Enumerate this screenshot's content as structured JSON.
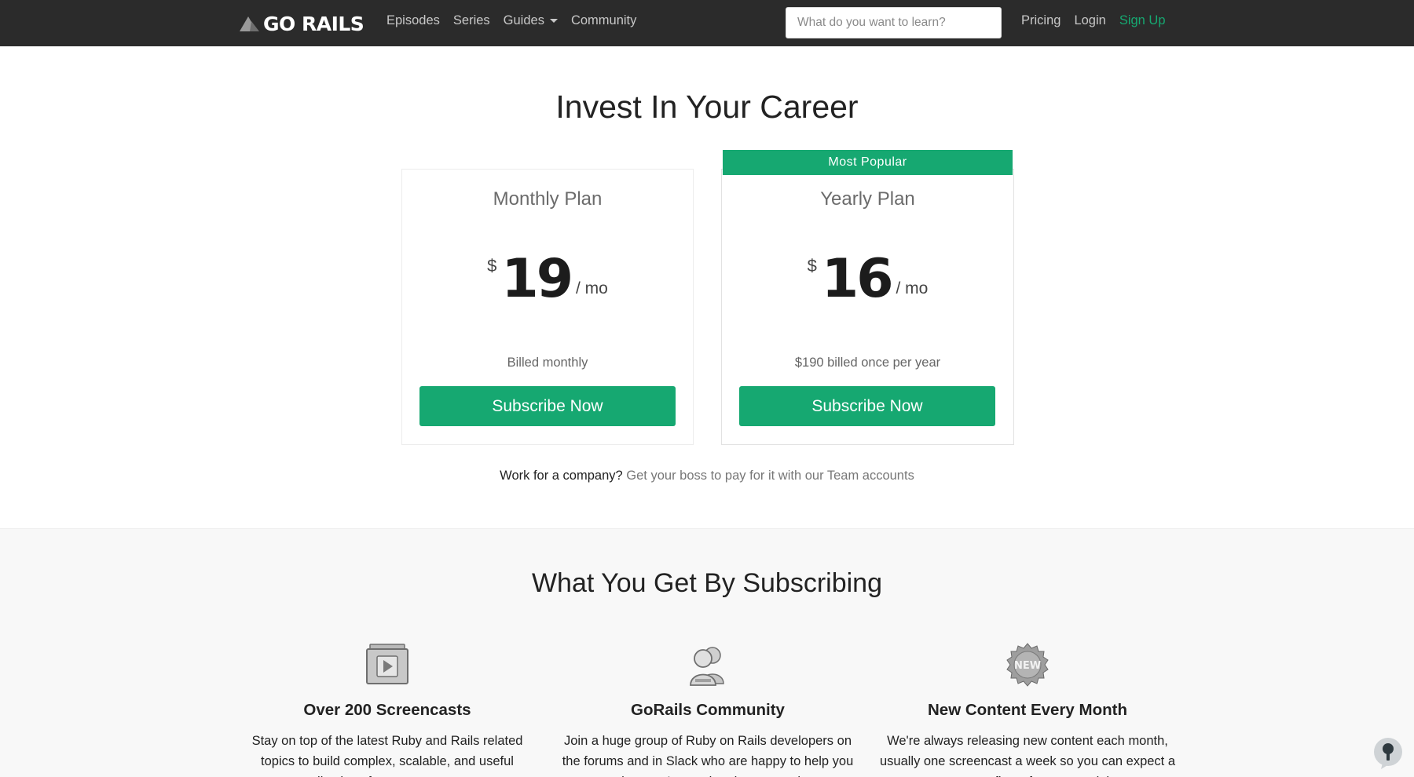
{
  "navbar": {
    "logo_text": "GO RAILS",
    "links": [
      "Episodes",
      "Series",
      "Guides",
      "Community"
    ],
    "search_placeholder": "What do you want to learn?",
    "right_links": [
      "Pricing",
      "Login",
      "Sign Up"
    ]
  },
  "hero": {
    "title": "Invest In Your Career"
  },
  "plans": [
    {
      "name": "Monthly Plan",
      "currency": "$",
      "price": "19",
      "period": "/ mo",
      "billing": "Billed monthly",
      "button": "Subscribe Now"
    },
    {
      "badge": "Most Popular",
      "name": "Yearly Plan",
      "currency": "$",
      "price": "16",
      "period": "/ mo",
      "billing": "$190 billed once per year",
      "button": "Subscribe Now"
    }
  ],
  "team": {
    "prefix": "Work for a company?",
    "link": "Get your boss to pay for it with our Team accounts"
  },
  "features": {
    "title": "What You Get By Subscribing",
    "items": [
      {
        "icon": "video-screencast-icon",
        "title": "Over 200 Screencasts",
        "text": "Stay on top of the latest Ruby and Rails related topics to build complex, scalable, and useful applications for your customers."
      },
      {
        "icon": "community-users-icon",
        "title": "GoRails Community",
        "text": "Join a huge group of Ruby on Rails developers on the forums and in Slack who are happy to help you out when you're stuck or have questions."
      },
      {
        "icon": "new-badge-icon",
        "title": "New Content Every Month",
        "text": "We're always releasing new content each month, usually one screencast a week so you can expect a constant flow of new material."
      }
    ]
  },
  "colors": {
    "navbar_bg": "#2b2b2b",
    "accent_green": "#16a871",
    "features_bg": "#f8f8f8"
  }
}
